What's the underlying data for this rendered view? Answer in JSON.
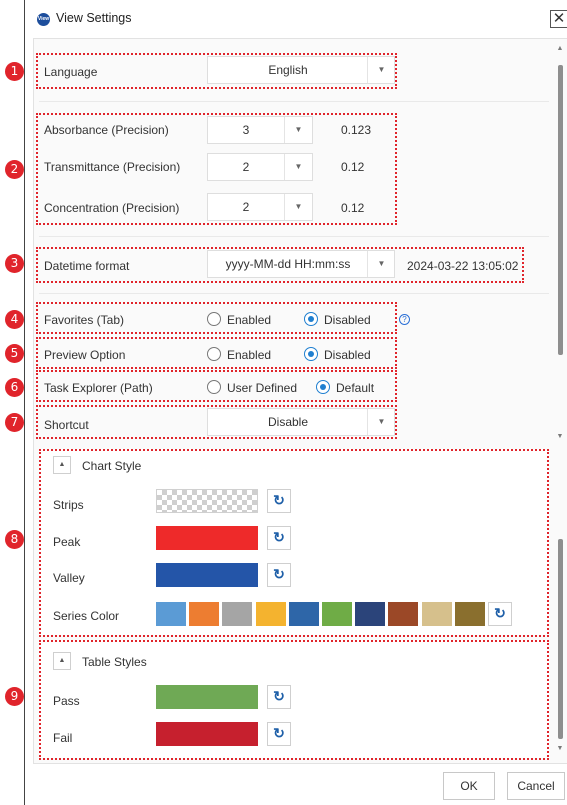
{
  "window": {
    "title": "View Settings",
    "app_icon_label": "View"
  },
  "settings": {
    "language": {
      "label": "Language",
      "value": "English"
    },
    "precision": [
      {
        "label": "Absorbance (Precision)",
        "value": "3",
        "sample": "0.123"
      },
      {
        "label": "Transmittance (Precision)",
        "value": "2",
        "sample": "0.12"
      },
      {
        "label": "Concentration (Precision)",
        "value": "2",
        "sample": "0.12"
      }
    ],
    "datetime": {
      "label": "Datetime format",
      "value": "yyyy-MM-dd HH:mm:ss",
      "sample": "2024-03-22 13:05:02"
    },
    "favorites": {
      "label": "Favorites (Tab)",
      "option1": "Enabled",
      "option2": "Disabled",
      "selected": "Disabled",
      "help": "?"
    },
    "preview": {
      "label": "Preview Option",
      "option1": "Enabled",
      "option2": "Disabled",
      "selected": "Disabled"
    },
    "task_explorer": {
      "label": "Task Explorer (Path)",
      "option1": "User Defined",
      "option2": "Default",
      "selected": "Default"
    },
    "shortcut": {
      "label": "Shortcut",
      "value": "Disable"
    }
  },
  "chart_style": {
    "title": "Chart Style",
    "strips_label": "Strips",
    "peak_label": "Peak",
    "peak_color": "#ee2a2a",
    "valley_label": "Valley",
    "valley_color": "#2455a8",
    "series_label": "Series Color",
    "series_colors": [
      "#5b9bd5",
      "#ed7d31",
      "#a5a5a5",
      "#f4b32f",
      "#2e66a8",
      "#6fac46",
      "#2b447a",
      "#9b4827",
      "#d6c08c",
      "#8a6f2e"
    ]
  },
  "table_styles": {
    "title": "Table Styles",
    "pass_label": "Pass",
    "pass_color": "#6fa955",
    "fail_label": "Fail",
    "fail_color": "#c6202e"
  },
  "annotations": [
    "1",
    "2",
    "3",
    "4",
    "5",
    "6",
    "7",
    "8",
    "9"
  ],
  "icons": {
    "reset": "↻",
    "dropdown": "▼",
    "collapse": "▲",
    "close": "✕"
  },
  "footer": {
    "ok_label": "OK",
    "cancel_label": "Cancel"
  },
  "colors": {
    "annotation": "#e0242b",
    "accent": "#1f7fd0"
  }
}
